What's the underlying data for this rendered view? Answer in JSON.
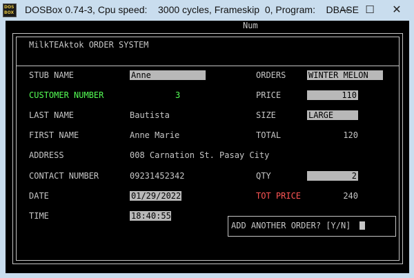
{
  "window": {
    "app_badge": [
      "DOS",
      "BOX"
    ],
    "title": "DOSBox 0.74-3, Cpu speed:    3000 cycles, Frameskip  0, Program:    DBASE",
    "minimize_glyph": "—",
    "maximize_glyph": "☐",
    "close_glyph": "✕"
  },
  "status": {
    "num": "Num"
  },
  "header": {
    "title": "MilkTEAktok ORDER SYSTEM"
  },
  "form": {
    "stub_name": {
      "label": "STUB NAME",
      "value": "Anne"
    },
    "customer_number": {
      "label": "CUSTOMER NUMBER",
      "value": "3"
    },
    "last_name": {
      "label": "LAST NAME",
      "value": "Bautista"
    },
    "first_name": {
      "label": "FIRST NAME",
      "value": "Anne Marie"
    },
    "address": {
      "label": "ADDRESS",
      "value": "008 Carnation St. Pasay City"
    },
    "contact_number": {
      "label": "CONTACT NUMBER",
      "value": "09231452342"
    },
    "date": {
      "label": "DATE",
      "value": "01/29/2022"
    },
    "time": {
      "label": "TIME",
      "value": "18:40:55"
    }
  },
  "order": {
    "orders": {
      "label": "ORDERS",
      "value": "WINTER MELON"
    },
    "price": {
      "label": "PRICE",
      "value": "110"
    },
    "size": {
      "label": "SIZE",
      "value": "LARGE"
    },
    "total": {
      "label": "TOTAL",
      "value": "120"
    },
    "qty": {
      "label": "QTY",
      "value": "2"
    },
    "tot_price": {
      "label": "TOT PRICE",
      "value": "240"
    }
  },
  "prompt": {
    "text": "ADD ANOTHER ORDER? [Y/N]"
  },
  "colors": {
    "screen_bg": "#000000",
    "text": "#c6c6c6",
    "field_bg": "#b8b8b8",
    "highlight_green": "#55ff55",
    "highlight_red": "#ff5555",
    "chrome_bg": "#c9ddee"
  }
}
